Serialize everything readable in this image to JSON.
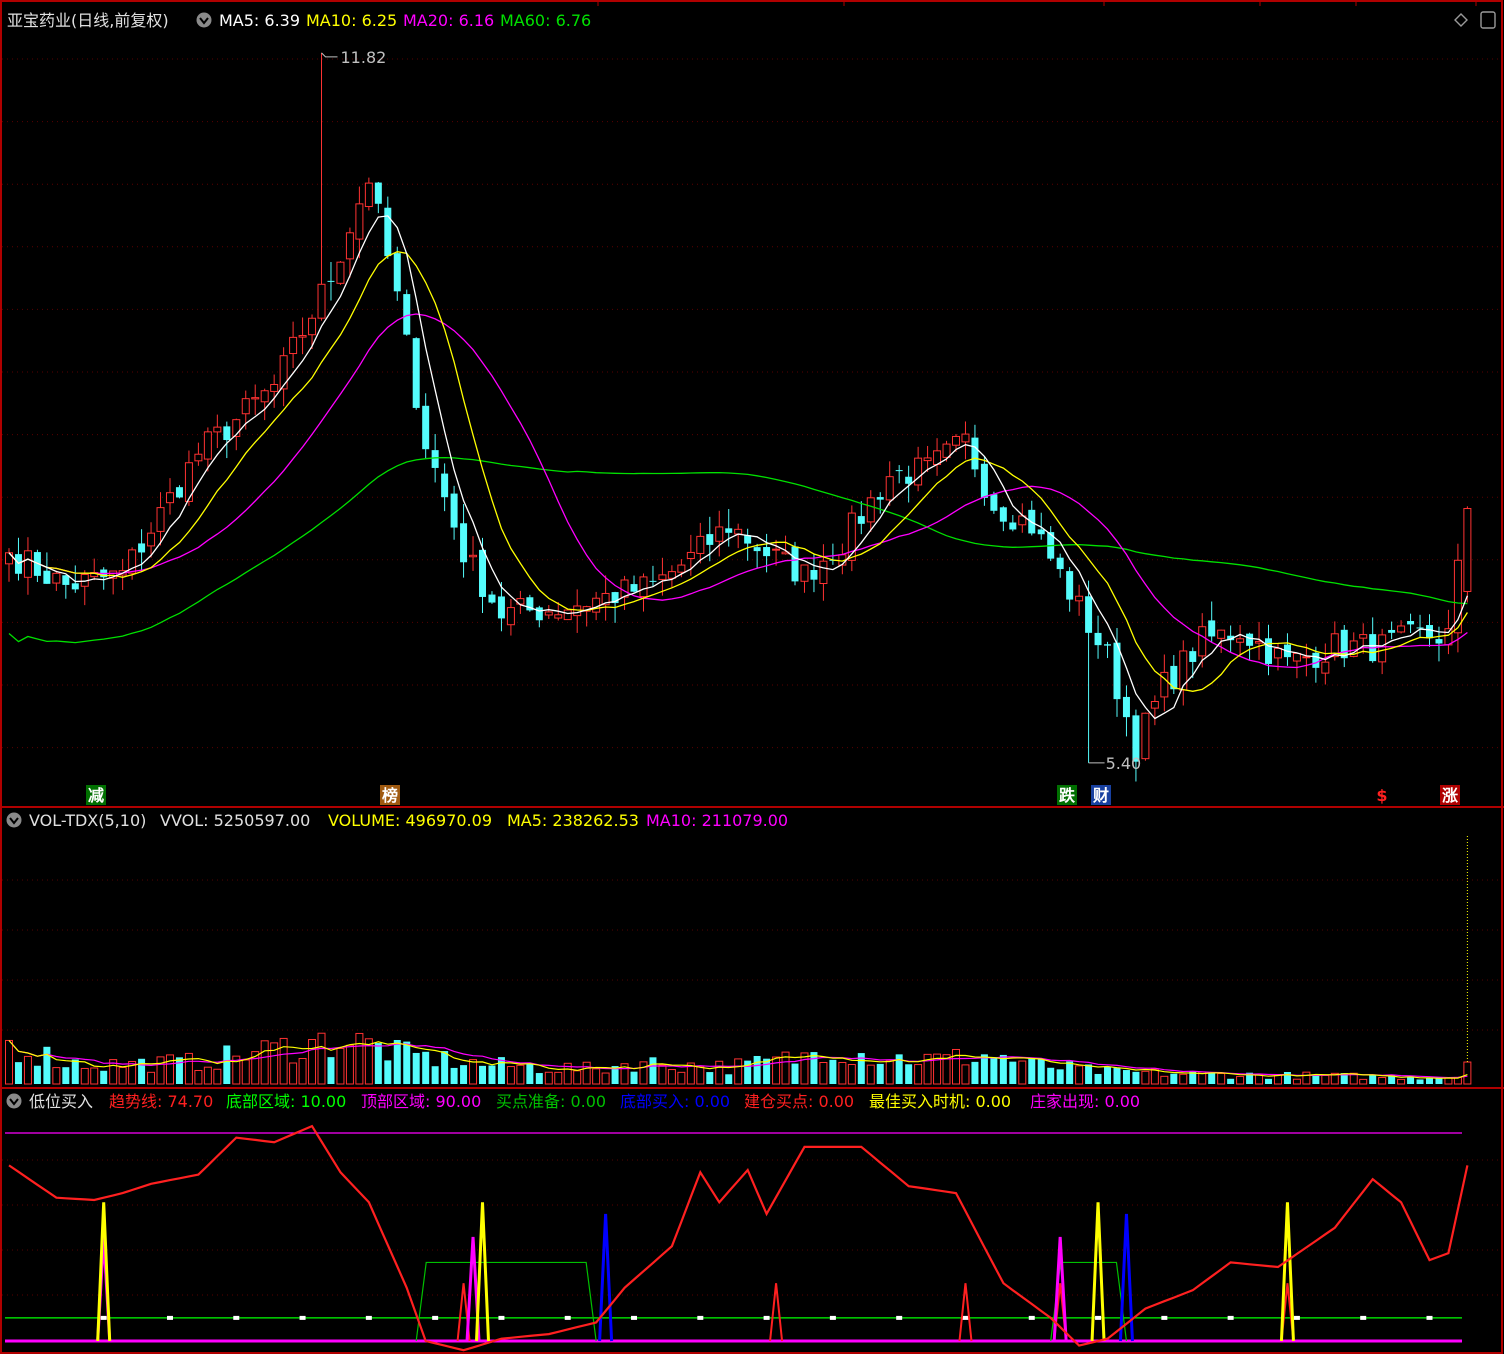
{
  "colors": {
    "background": "#000000",
    "frame": "#b00000",
    "grid": "#5a0000",
    "up": "#ff3232",
    "down": "#54fcfc",
    "ma5": "#ffffff",
    "ma10": "#ffff00",
    "ma20": "#ff00ff",
    "ma60": "#00e000",
    "vol_ma5": "#ffff00",
    "vol_ma10": "#ff00ff",
    "trend": "#ff2020",
    "bottom_zone": "#00ff00",
    "top_zone": "#ff00ff",
    "buy_prep": "#00c000",
    "bottom_buy": "#0000ff",
    "build_buy": "#ff2020",
    "best_buy": "#ffff00",
    "dealer": "#ff00ff"
  },
  "price_header": {
    "title": "亚宝药业(日线,前复权)",
    "ma5": "MA5: 6.39",
    "ma10": "MA10: 6.25",
    "ma20": "MA20: 6.16",
    "ma60": "MA60: 6.76"
  },
  "price_annotations": {
    "high": "11.82",
    "low": "5.40"
  },
  "event_tags": [
    {
      "text": "减",
      "bg": "#007000",
      "fg": "#ffffff"
    },
    {
      "text": "榜",
      "bg": "#a05a10",
      "fg": "#ffffff"
    },
    {
      "text": "跌",
      "bg": "#007000",
      "fg": "#ffffff"
    },
    {
      "text": "财",
      "bg": "#1840a0",
      "fg": "#ffffff"
    },
    {
      "text": "$",
      "bg": "#000000",
      "fg": "#ff2020"
    },
    {
      "text": "涨",
      "bg": "#b00000",
      "fg": "#ffffff"
    }
  ],
  "volume_header": {
    "name": "VOL-TDX(5,10)",
    "vvol": "VVOL: 5250597.00",
    "volume": "VOLUME: 496970.09",
    "ma5": "MA5: 238262.53",
    "ma10": "MA10: 211079.00"
  },
  "indicator_header": {
    "name": "低位买入",
    "trend": "趋势线: 74.70",
    "bottom_zone": "底部区域: 10.00",
    "top_zone": "顶部区域: 90.00",
    "buy_prep": "买点准备: 0.00",
    "bottom_buy": "底部买入: 0.00",
    "build_buy": "建仓买点: 0.00",
    "best_buy": "最佳买入时机: 0.00",
    "dealer": "庄家出现: 0.00"
  },
  "chart_data": [
    {
      "type": "candlestick",
      "title": "亚宝药业(日线,前复权)",
      "price_range": [
        5.2,
        12.0
      ],
      "high_point": 11.82,
      "low_point": 5.4,
      "last_close": 7.7,
      "close_anchors": [
        [
          0,
          7.3
        ],
        [
          6,
          7.0
        ],
        [
          12,
          7.1
        ],
        [
          20,
          8.2
        ],
        [
          28,
          8.8
        ],
        [
          34,
          9.8
        ],
        [
          38,
          10.7
        ],
        [
          41,
          9.6
        ],
        [
          44,
          8.3
        ],
        [
          48,
          7.3
        ],
        [
          52,
          6.75
        ],
        [
          58,
          6.8
        ],
        [
          63,
          6.9
        ],
        [
          68,
          7.0
        ],
        [
          72,
          7.25
        ],
        [
          76,
          7.55
        ],
        [
          80,
          7.3
        ],
        [
          84,
          7.1
        ],
        [
          88,
          7.4
        ],
        [
          93,
          8.0
        ],
        [
          97,
          8.05
        ],
        [
          101,
          8.3
        ],
        [
          104,
          7.75
        ],
        [
          108,
          7.55
        ],
        [
          112,
          6.95
        ],
        [
          116,
          6.35
        ],
        [
          119,
          5.55
        ],
        [
          122,
          6.1
        ],
        [
          126,
          6.5
        ],
        [
          130,
          6.6
        ],
        [
          135,
          6.3
        ],
        [
          140,
          6.45
        ],
        [
          145,
          6.45
        ],
        [
          149,
          6.55
        ],
        [
          152,
          6.55
        ],
        [
          154,
          7.7
        ]
      ],
      "count": 155
    },
    {
      "type": "bar",
      "title": "VOL-TDX(5,10)",
      "series": [
        {
          "name": "VOLUME",
          "last": 496970.09
        },
        {
          "name": "MA5",
          "last": 238262.53
        },
        {
          "name": "MA10",
          "last": 211079.0
        }
      ],
      "vvol": 5250597.0,
      "relative_anchors": [
        [
          0,
          0.16
        ],
        [
          3,
          0.13
        ],
        [
          6,
          0.09
        ],
        [
          10,
          0.08
        ],
        [
          20,
          0.09
        ],
        [
          26,
          0.13
        ],
        [
          31,
          0.16
        ],
        [
          35,
          0.18
        ],
        [
          38,
          0.16
        ],
        [
          42,
          0.12
        ],
        [
          50,
          0.08
        ],
        [
          56,
          0.07
        ],
        [
          62,
          0.06
        ],
        [
          66,
          0.09
        ],
        [
          70,
          0.08
        ],
        [
          76,
          0.07
        ],
        [
          80,
          0.09
        ],
        [
          84,
          0.11
        ],
        [
          86,
          0.16
        ],
        [
          88,
          0.14
        ],
        [
          92,
          0.11
        ],
        [
          98,
          0.1
        ],
        [
          104,
          0.12
        ],
        [
          108,
          0.08
        ],
        [
          116,
          0.05
        ],
        [
          126,
          0.04
        ],
        [
          146,
          0.03
        ],
        [
          153,
          0.03
        ],
        [
          154,
          0.09
        ]
      ]
    },
    {
      "type": "line",
      "title": "低位买入",
      "ylim": [
        0,
        100
      ],
      "levels": {
        "顶部区域": 90,
        "底部区域": 10
      },
      "trend_last": 74.7,
      "trend_anchors": [
        [
          0,
          76
        ],
        [
          5,
          62
        ],
        [
          9,
          61
        ],
        [
          12,
          64
        ],
        [
          15,
          68
        ],
        [
          20,
          72
        ],
        [
          24,
          88
        ],
        [
          28,
          86
        ],
        [
          32,
          93
        ],
        [
          35,
          73
        ],
        [
          38,
          60
        ],
        [
          42,
          23
        ],
        [
          44,
          0
        ],
        [
          48,
          -4
        ],
        [
          52,
          1
        ],
        [
          57,
          3
        ],
        [
          62,
          8
        ],
        [
          65,
          23
        ],
        [
          70,
          41
        ],
        [
          73,
          73
        ],
        [
          75,
          60
        ],
        [
          78,
          74
        ],
        [
          80,
          55
        ],
        [
          84,
          84
        ],
        [
          90,
          84
        ],
        [
          95,
          67
        ],
        [
          100,
          64
        ],
        [
          105,
          25
        ],
        [
          110,
          10
        ],
        [
          113,
          -2
        ],
        [
          116,
          1
        ],
        [
          120,
          14
        ],
        [
          125,
          22
        ],
        [
          129,
          34
        ],
        [
          134,
          32
        ],
        [
          140,
          49
        ],
        [
          144,
          70
        ],
        [
          147,
          60
        ],
        [
          150,
          35
        ],
        [
          152,
          38
        ],
        [
          154,
          76
        ]
      ],
      "buy_prep_segments": [
        [
          43,
          62
        ],
        [
          110,
          118
        ]
      ],
      "best_buy_spikes": [
        10,
        50,
        115,
        135
      ],
      "dealer_spikes": [
        10,
        49,
        111
      ],
      "bottom_buy_spikes": [
        63,
        118
      ],
      "build_buy_spikes": [
        48,
        81,
        101,
        111,
        135
      ]
    }
  ]
}
